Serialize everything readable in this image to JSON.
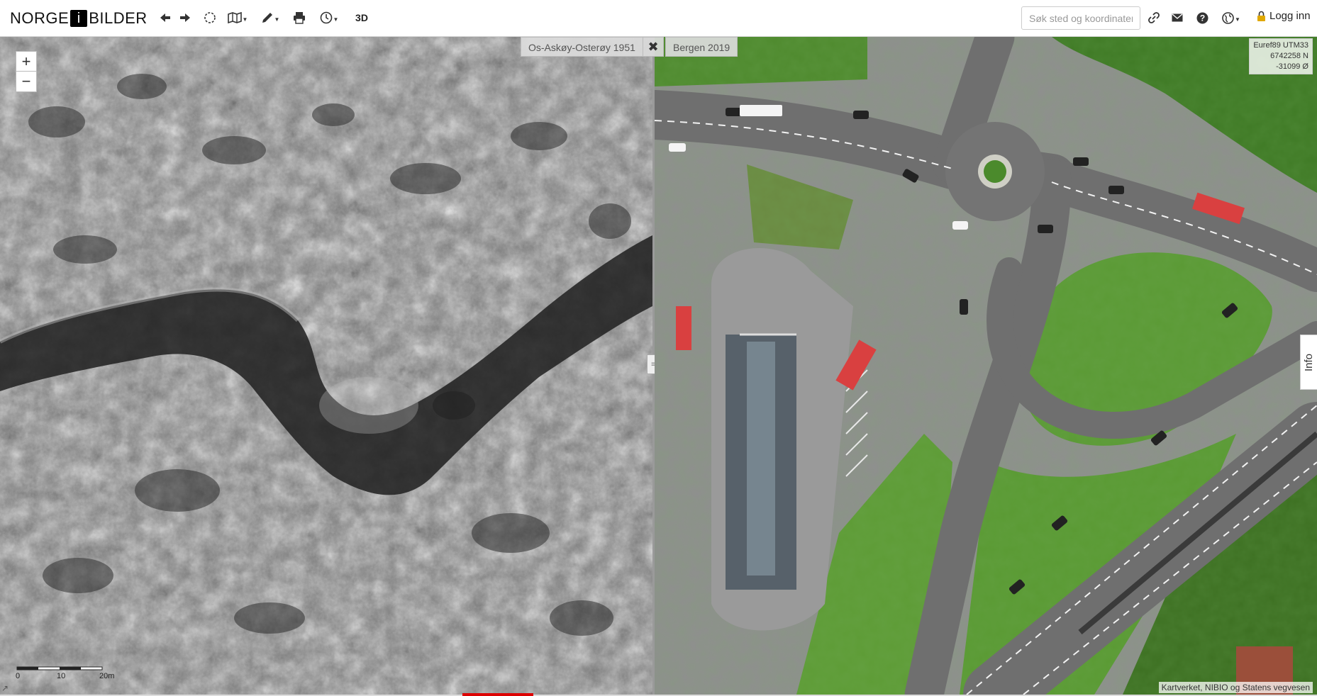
{
  "toolbar": {
    "logo_left": "NORGE",
    "logo_mid": "i",
    "logo_right": "BILDER",
    "btn_3d": "3D",
    "search_placeholder": "Søk sted og koordinater",
    "login_label": "Logg inn",
    "icons": [
      "arrow-left-icon",
      "arrow-right-icon",
      "select-circle-icon",
      "map-layers-icon",
      "pencil-icon",
      "print-icon",
      "clock-icon",
      "link-icon",
      "mail-icon",
      "help-icon",
      "globe-icon",
      "lock-icon"
    ]
  },
  "map": {
    "left_layer": "Os-Askøy-Osterøy 1951",
    "right_layer": "Bergen 2019",
    "close_symbol": "✖",
    "zoom_in": "+",
    "zoom_out": "−",
    "coords": {
      "system": "Euref89 UTM33",
      "north": "6742258 N",
      "east": "-31099 Ø"
    },
    "info_tab": "Info",
    "attribution": "Kartverket, NIBIO og Statens vegvesen",
    "divider_handle": "≡",
    "scale": {
      "labels": [
        "0",
        "10",
        "20m"
      ]
    }
  },
  "colors": {
    "accent_red": "#dd0000",
    "lock_gold": "#e0a800"
  }
}
